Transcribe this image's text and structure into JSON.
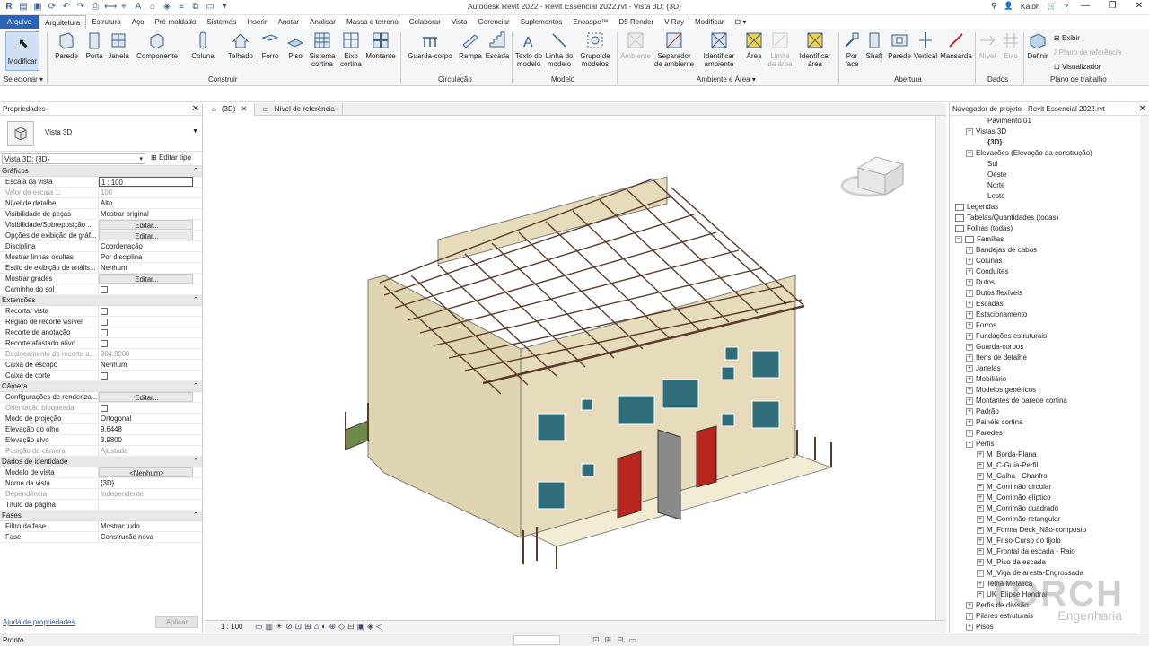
{
  "window": {
    "title": "Autodesk Revit 2022 - Revit Essencial 2022.rvt - Vista 3D: {3D}",
    "user": "Kaioh"
  },
  "tabs": [
    "Arquivo",
    "Arquitetura",
    "Estrutura",
    "Aço",
    "Pré-moldado",
    "Sistemas",
    "Inserir",
    "Anotar",
    "Analisar",
    "Massa e terreno",
    "Colaborar",
    "Vista",
    "Gerenciar",
    "Suplementos",
    "Encaspe™",
    "D5 Render",
    "V-Ray",
    "Modificar"
  ],
  "ribbon": {
    "modify": "Modificar",
    "select_label": "Selecionar",
    "build": [
      "Parede",
      "Porta",
      "Janela",
      "Componente",
      "Coluna",
      "Telhado",
      "Forro",
      "Piso",
      "Sistema cortina",
      "Eixo cortina",
      "Montante"
    ],
    "build_panel": "Construir",
    "circulation": [
      "Guarda-corpo",
      "Rampa",
      "Escada"
    ],
    "circulation_panel": "Circulação",
    "model": [
      "Texto do modelo",
      "Linha do modelo",
      "Grupo de modelos"
    ],
    "model_panel": "Modelo",
    "room": [
      "Ambiente",
      "Separador de ambiente",
      "Identificar ambiente",
      "Área",
      "Limite de área",
      "Identificar área"
    ],
    "room_panel": "Ambiente e Área",
    "opening": [
      "Por face",
      "Shaft",
      "Parede",
      "Vertical",
      "Mansarda"
    ],
    "opening_panel": "Abertura",
    "datum": [
      "Nível",
      "Eixo"
    ],
    "datum_panel": "Dados",
    "work_plane": [
      "Definir",
      "Exibir",
      "Plano de referência",
      "Visualizador"
    ],
    "work_plane_panel": "Plano de trabalho"
  },
  "properties": {
    "title": "Propriedades",
    "type_name": "Vista 3D",
    "view_selector": "Vista 3D: {3D}",
    "edit_type": "Editar tipo",
    "groups": [
      {
        "name": "Gráficos",
        "rows": [
          {
            "k": "Escala da vista",
            "v": "1 : 100",
            "kind": "field"
          },
          {
            "k": "Valor de escala    1:",
            "v": "100",
            "kind": "grey"
          },
          {
            "k": "Nível de detalhe",
            "v": "Alto"
          },
          {
            "k": "Visibilidade de peças",
            "v": "Mostrar original"
          },
          {
            "k": "Visibilidade/Sobreposição ...",
            "v": "Editar...",
            "kind": "btn"
          },
          {
            "k": "Opções de exibição de gráf...",
            "v": "Editar...",
            "kind": "btn"
          },
          {
            "k": "Disciplina",
            "v": "Coordenação"
          },
          {
            "k": "Mostrar linhas ocultas",
            "v": "Por disciplina"
          },
          {
            "k": "Estilo de exibição de anális...",
            "v": "Nenhum"
          },
          {
            "k": "Mostrar grades",
            "v": "Editar...",
            "kind": "btn"
          },
          {
            "k": "Caminho do sol",
            "v": "",
            "kind": "cb"
          }
        ]
      },
      {
        "name": "Extensões",
        "rows": [
          {
            "k": "Recortar vista",
            "v": "",
            "kind": "cb"
          },
          {
            "k": "Região de recorte visível",
            "v": "",
            "kind": "cb"
          },
          {
            "k": "Recorte de anotação",
            "v": "",
            "kind": "cb"
          },
          {
            "k": "Recorte afastado ativo",
            "v": "",
            "kind": "cb"
          },
          {
            "k": "Deslocamento do recorte a...",
            "v": "304.8000",
            "kind": "grey"
          },
          {
            "k": "Caixa de escopo",
            "v": "Nenhum"
          },
          {
            "k": "Caixa de corte",
            "v": "",
            "kind": "cb"
          }
        ]
      },
      {
        "name": "Câmera",
        "rows": [
          {
            "k": "Configurações de renderiza...",
            "v": "Editar...",
            "kind": "btn"
          },
          {
            "k": "Orientação bloqueada",
            "v": "",
            "kind": "greycb"
          },
          {
            "k": "Modo de projeção",
            "v": "Ortogonal"
          },
          {
            "k": "Elevação do olho",
            "v": "9.6448"
          },
          {
            "k": "Elevação alvo",
            "v": "3.9800"
          },
          {
            "k": "Posição da câmera",
            "v": "Ajustada",
            "kind": "grey"
          }
        ]
      },
      {
        "name": "Dados de identidade",
        "rows": [
          {
            "k": "Modelo de vista",
            "v": "<Nenhum>",
            "kind": "btn"
          },
          {
            "k": "Nome da vista",
            "v": "{3D}"
          },
          {
            "k": "Dependência",
            "v": "Independente",
            "kind": "grey"
          },
          {
            "k": "Título da página",
            "v": ""
          }
        ]
      },
      {
        "name": "Fases",
        "rows": [
          {
            "k": "Filtro da fase",
            "v": "Mostrar tudo"
          },
          {
            "k": "Fase",
            "v": "Construção nova"
          }
        ]
      }
    ],
    "help_link": "Ajuda de propriedades",
    "apply": "Aplicar"
  },
  "view": {
    "tabs": [
      "(3D)",
      "Nível de referência"
    ],
    "scale": "1 : 100",
    "colors": {
      "wall": "#e6dcbc",
      "wall_shadow": "#d2c69f",
      "pergola": "#5a3a2a",
      "door_red": "#b8251c",
      "door_grey": "#8a8a8a",
      "window": "#2f6d7a",
      "floor": "#f2ecd2"
    }
  },
  "browser": {
    "title": "Navegador de projeto - Revit Essencial 2022.rvt",
    "items": [
      {
        "label": "Pavimento 01",
        "indent": 3,
        "exp": ""
      },
      {
        "label": "Vistas 3D",
        "indent": 1,
        "exp": "−"
      },
      {
        "label": "{3D}",
        "indent": 3,
        "exp": "",
        "bold": true
      },
      {
        "label": "Elevações (Elevação da construção)",
        "indent": 1,
        "exp": "−"
      },
      {
        "label": "Sul",
        "indent": 3,
        "exp": ""
      },
      {
        "label": "Oeste",
        "indent": 3,
        "exp": ""
      },
      {
        "label": "Norte",
        "indent": 3,
        "exp": ""
      },
      {
        "label": "Leste",
        "indent": 3,
        "exp": ""
      },
      {
        "label": "Legendas",
        "indent": 0,
        "exp": "",
        "icon": true
      },
      {
        "label": "Tabelas/Quantidades (todas)",
        "indent": 0,
        "exp": "",
        "icon": true
      },
      {
        "label": "Folhas (todas)",
        "indent": 0,
        "exp": "",
        "icon": true
      },
      {
        "label": "Famílias",
        "indent": 0,
        "exp": "−",
        "icon": true
      },
      {
        "label": "Bandejas de cabos",
        "indent": 1,
        "exp": "+"
      },
      {
        "label": "Colunas",
        "indent": 1,
        "exp": "+"
      },
      {
        "label": "Conduítes",
        "indent": 1,
        "exp": "+"
      },
      {
        "label": "Dutos",
        "indent": 1,
        "exp": "+"
      },
      {
        "label": "Dutos flexíveis",
        "indent": 1,
        "exp": "+"
      },
      {
        "label": "Escadas",
        "indent": 1,
        "exp": "+"
      },
      {
        "label": "Estacionamento",
        "indent": 1,
        "exp": "+"
      },
      {
        "label": "Forros",
        "indent": 1,
        "exp": "+"
      },
      {
        "label": "Fundações estruturais",
        "indent": 1,
        "exp": "+"
      },
      {
        "label": "Guarda-corpos",
        "indent": 1,
        "exp": "+"
      },
      {
        "label": "Itens de detalhe",
        "indent": 1,
        "exp": "+"
      },
      {
        "label": "Janelas",
        "indent": 1,
        "exp": "+"
      },
      {
        "label": "Mobiliário",
        "indent": 1,
        "exp": "+"
      },
      {
        "label": "Modelos genéricos",
        "indent": 1,
        "exp": "+"
      },
      {
        "label": "Montantes de parede cortina",
        "indent": 1,
        "exp": "+"
      },
      {
        "label": "Padrão",
        "indent": 1,
        "exp": "+"
      },
      {
        "label": "Painéis cortina",
        "indent": 1,
        "exp": "+"
      },
      {
        "label": "Paredes",
        "indent": 1,
        "exp": "+"
      },
      {
        "label": "Perfis",
        "indent": 1,
        "exp": "−"
      },
      {
        "label": "M_Borda-Plana",
        "indent": 2,
        "exp": "+"
      },
      {
        "label": "M_C-Guia-Perfil",
        "indent": 2,
        "exp": "+"
      },
      {
        "label": "M_Calha - Chanfro",
        "indent": 2,
        "exp": "+"
      },
      {
        "label": "M_Corrimão circular",
        "indent": 2,
        "exp": "+"
      },
      {
        "label": "M_Corrimão elíptico",
        "indent": 2,
        "exp": "+"
      },
      {
        "label": "M_Corrimão quadrado",
        "indent": 2,
        "exp": "+"
      },
      {
        "label": "M_Corrimão retangular",
        "indent": 2,
        "exp": "+"
      },
      {
        "label": "M_Forma Deck_Não-composto",
        "indent": 2,
        "exp": "+"
      },
      {
        "label": "M_Friso-Curso do tijolo",
        "indent": 2,
        "exp": "+"
      },
      {
        "label": "M_Frontal da escada - Raio",
        "indent": 2,
        "exp": "+"
      },
      {
        "label": "M_Piso da escada",
        "indent": 2,
        "exp": "+"
      },
      {
        "label": "M_Viga de aresta-Engrossada",
        "indent": 2,
        "exp": "+"
      },
      {
        "label": "Telha Metalica",
        "indent": 2,
        "exp": "+"
      },
      {
        "label": "UK_Elipse Handrail",
        "indent": 2,
        "exp": "+"
      },
      {
        "label": "Perfis de divisão",
        "indent": 1,
        "exp": "+"
      },
      {
        "label": "Pilares estruturais",
        "indent": 1,
        "exp": "+"
      },
      {
        "label": "Pisos",
        "indent": 1,
        "exp": "+"
      }
    ]
  },
  "status": {
    "text": "Pronto"
  },
  "watermark": {
    "main": "TORCH",
    "sub": "Engenharia"
  }
}
